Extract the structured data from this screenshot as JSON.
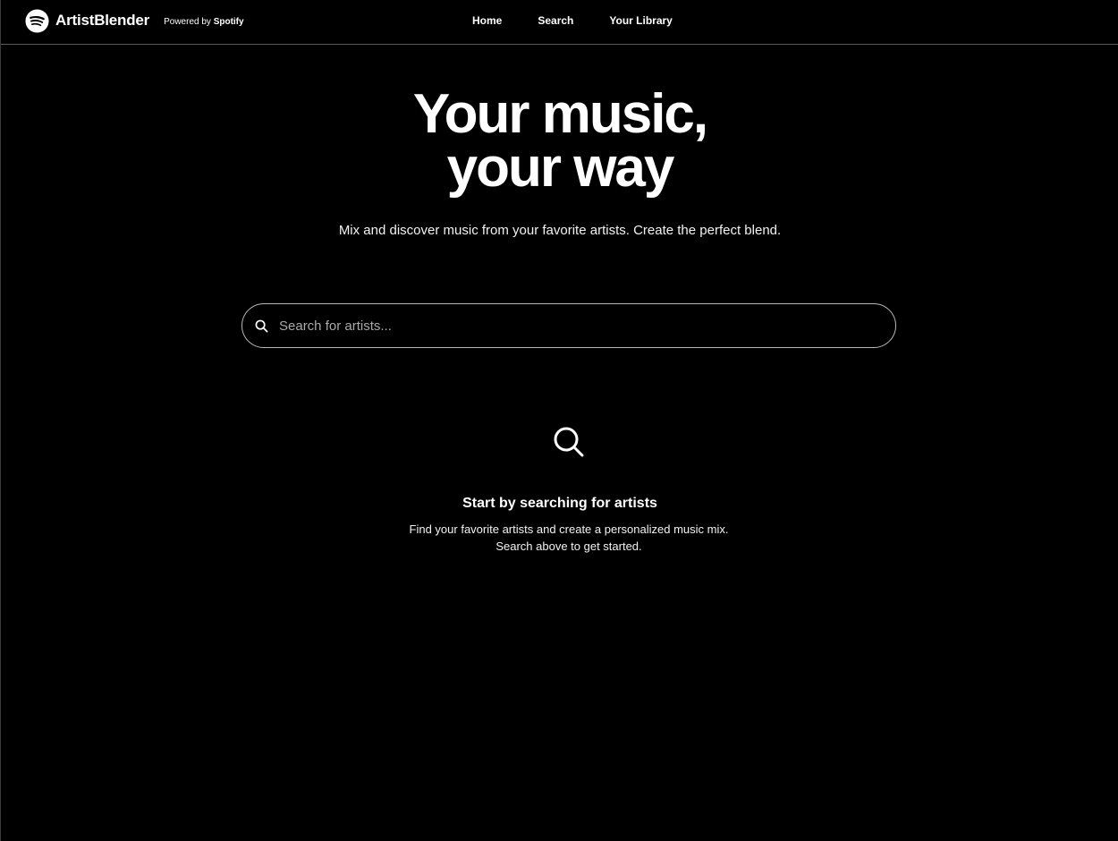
{
  "header": {
    "brand_name": "ArtistBlender",
    "powered_prefix": "Powered by",
    "powered_brand": "Spotify",
    "logo_icon": "spotify-logo-icon",
    "nav": [
      {
        "label": "Home"
      },
      {
        "label": "Search"
      },
      {
        "label": "Your Library"
      }
    ]
  },
  "hero": {
    "title_line1": "Your music,",
    "title_line2": "your way",
    "subtitle": "Mix and discover music from your favorite artists. Create the perfect blend."
  },
  "search": {
    "placeholder": "Search for artists...",
    "value": "",
    "icon": "search-icon"
  },
  "empty_state": {
    "icon": "search-icon",
    "title": "Start by searching for artists",
    "description": "Find your favorite artists and create a personalized music mix. Search above to get started."
  },
  "colors": {
    "background": "#000000",
    "text": "#ffffff",
    "border": "#b9b9b9",
    "placeholder": "#a9a9a9"
  }
}
